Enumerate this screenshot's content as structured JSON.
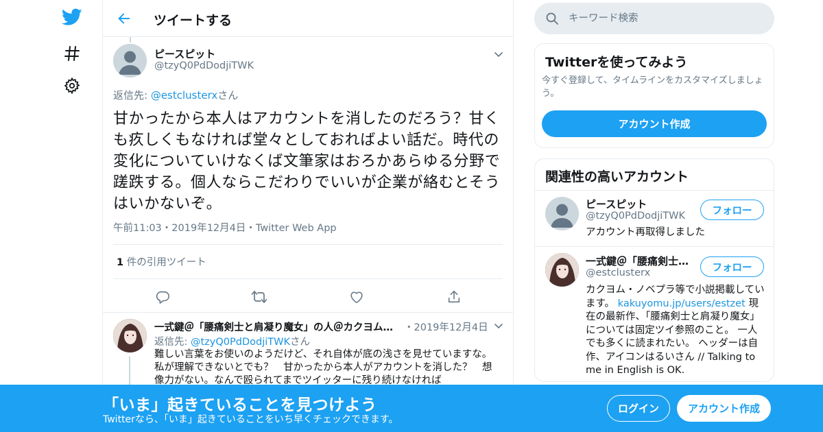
{
  "colors": {
    "brand": "#1da1f2",
    "link": "#1b95e0",
    "muted": "#657786",
    "border": "#e6ecf0"
  },
  "nav": {
    "icons": [
      "twitter-bird-icon",
      "hashtag-icon",
      "gear-icon"
    ]
  },
  "header": {
    "title": "ツイートする"
  },
  "tweet": {
    "author_name": "ピースピット",
    "author_handle": "@tzyQ0PdDodjiTWK",
    "reply_prefix": "返信先: ",
    "reply_handle": "@estclusterx",
    "reply_suffix": "さん",
    "text": "甘かったから本人はアカウントを消したのだろう？甘くも疚しくもなければ堂々としておればよい話だ。時代の変化についていけなくば文筆家はおろかあらゆる分野で蹉跌する。個人ならこだわりでいいが企業が絡むとそうはいかないぞ。",
    "meta": "午前11:03・2019年12月4日・Twitter Web App",
    "quote_count": "1",
    "quote_label": " 件の引用ツイート"
  },
  "reply": {
    "author_name": "一式鍵＠「腰痛剣士と肩凝り魔女」の人＠カクヨム…",
    "date": "・2019年12月4日",
    "reply_prefix": "返信先: ",
    "reply_handle": "@tzyQ0PdDodjiTWK",
    "reply_suffix": "さん",
    "text": "難しい言葉をお使いのようだけど、それ自体が底の浅さを見せていますな。私が理解できないとでも？　甘かったから本人がアカウントを消した？　想像力がない。なんで殴られてまでツイッターに残り続けなければ"
  },
  "search": {
    "placeholder": "キーワード検索"
  },
  "signup_card": {
    "title": "Twitterを使ってみよう",
    "subtitle": "今すぐ登録して、タイムラインをカスタマイズしましょう。",
    "button": "アカウント作成"
  },
  "related": {
    "title": "関連性の高いアカウント",
    "follow_label": "フォロー",
    "accounts": [
      {
        "name": "ピースピット",
        "handle": "@tzyQ0PdDodjiTWK",
        "bio": "アカウント再取得しました"
      },
      {
        "name": "一式鍵＠「腰痛剣士…",
        "handle": "@estclusterx",
        "bio_before": "カクヨム・ノベプラ等で小説掲載しています。 ",
        "bio_link": "kakuyomu.jp/users/estzet",
        "bio_after": " 現在の最新作、「腰痛剣士と肩凝り魔女」については固定ツイ参照のこと。 一人でも多くに読まれたい。 ヘッダーは自作、アイコンはるいさん // Talking to me in English is OK."
      }
    ]
  },
  "banner": {
    "title": "「いま」起きていることを見つけよう",
    "subtitle": "Twitterなら、「いま」起きていることをいち早くチェックできます。",
    "login": "ログイン",
    "signup": "アカウント作成"
  }
}
